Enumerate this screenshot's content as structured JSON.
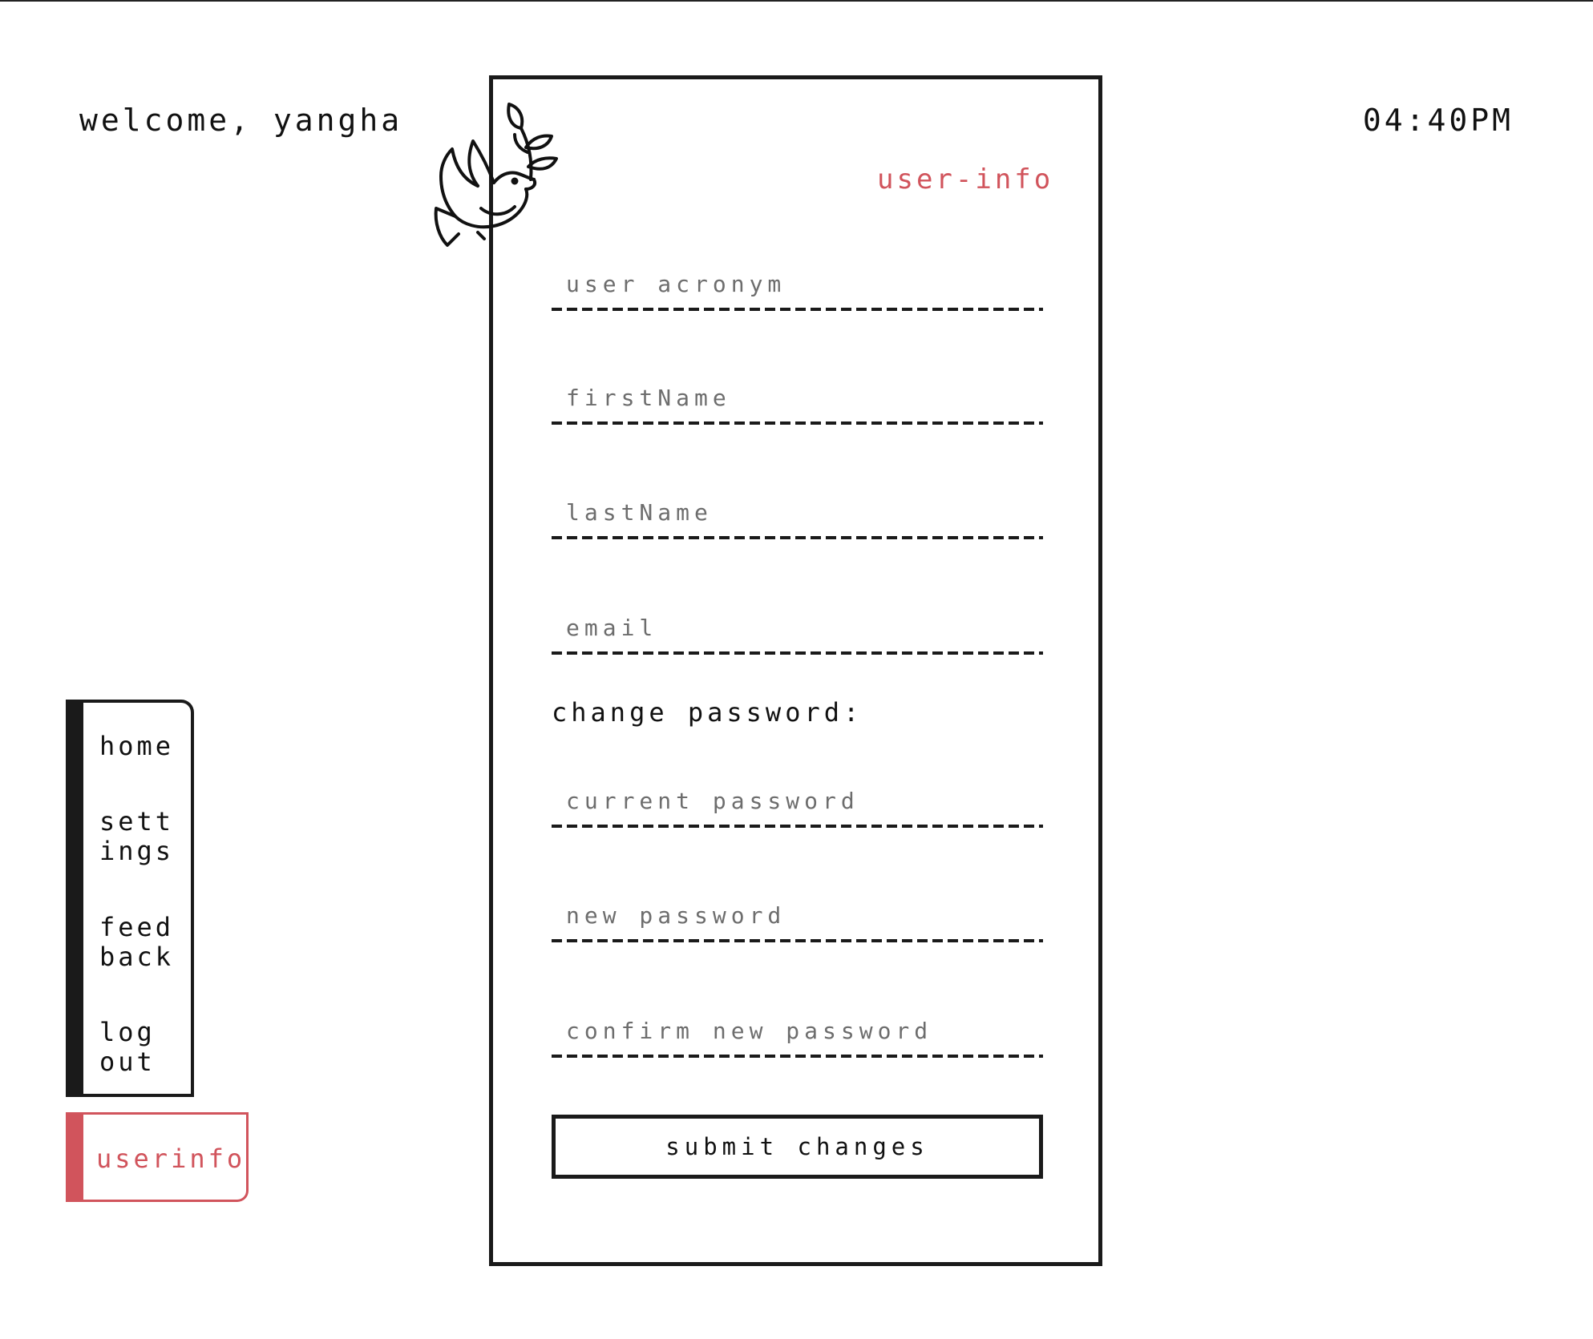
{
  "header": {
    "welcome_text": "welcome, yangha",
    "time": "04:40PM"
  },
  "sidebar": {
    "items": [
      {
        "label": "home"
      },
      {
        "label": "sett\nings"
      },
      {
        "label": "feed\nback"
      },
      {
        "label": "log\nout"
      }
    ],
    "active_tab": {
      "label": "userinfo"
    }
  },
  "form": {
    "title": "user-info",
    "logo_icon": "dove-with-olive-branch-icon",
    "fields": [
      {
        "placeholder": "user acronym",
        "value": ""
      },
      {
        "placeholder": "firstName",
        "value": ""
      },
      {
        "placeholder": "lastName",
        "value": ""
      },
      {
        "placeholder": "email",
        "value": ""
      }
    ],
    "password_section_label": "change password:",
    "password_fields": [
      {
        "placeholder": "current password",
        "value": ""
      },
      {
        "placeholder": "new password",
        "value": ""
      },
      {
        "placeholder": "confirm new password",
        "value": ""
      }
    ],
    "submit_label": "submit changes"
  },
  "colors": {
    "accent": "#d1545c",
    "ink": "#1a1a1a",
    "placeholder": "#6d6d6d"
  }
}
